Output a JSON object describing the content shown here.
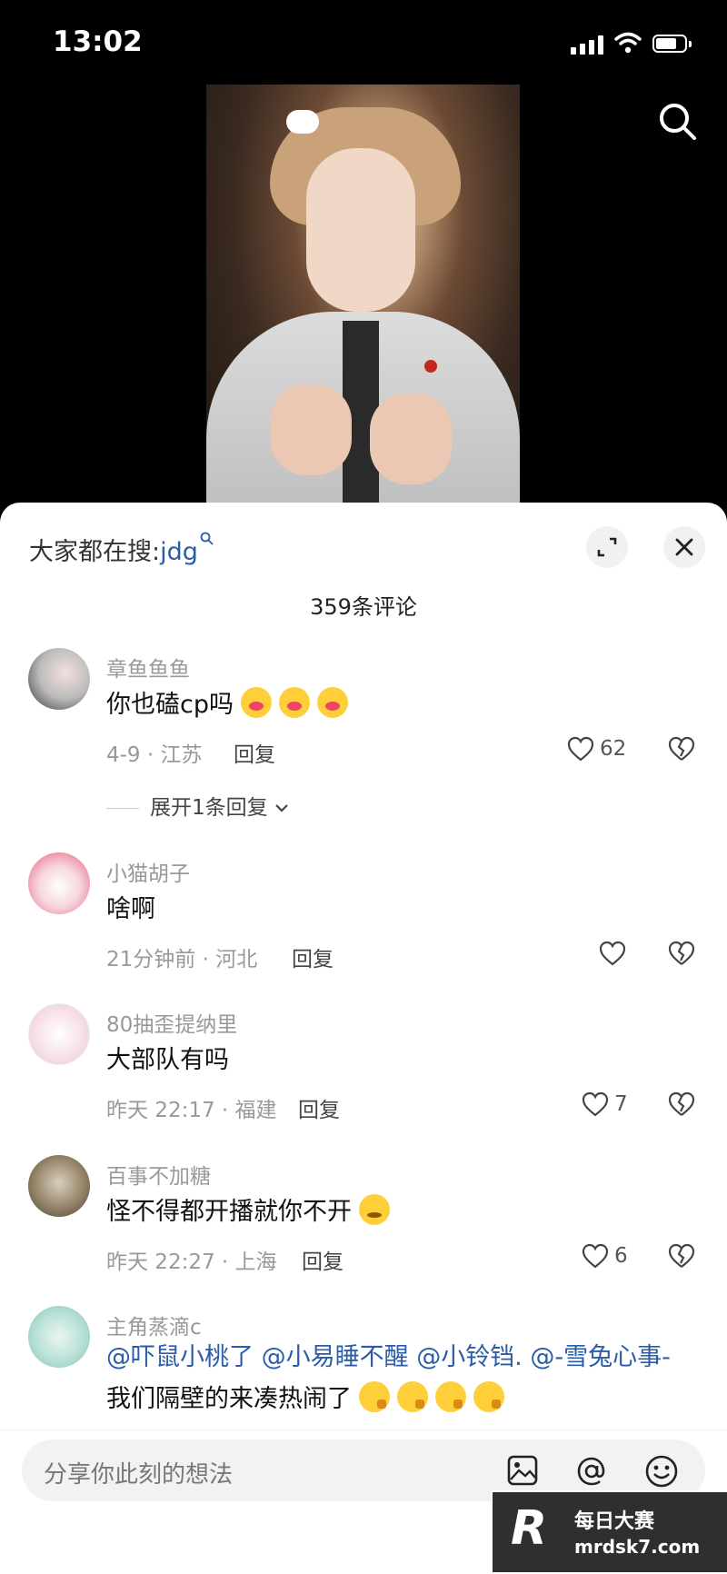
{
  "status": {
    "time": "13:02"
  },
  "video": {},
  "sheet": {
    "hot_search_label": "大家都在搜:",
    "hot_search_term": "jdg",
    "comment_count_label": "359条评论"
  },
  "comments": [
    {
      "name": "章鱼鱼鱼",
      "text": "你也磕cp吗",
      "meta": "4-9 · 江苏",
      "reply": "回复",
      "likes": "62",
      "expand": "展开1条回复",
      "emoji_count": 3
    },
    {
      "name": "小猫胡子",
      "text": "啥啊",
      "meta": "21分钟前 · 河北",
      "reply": "回复",
      "likes": ""
    },
    {
      "name": "80抽歪提纳里",
      "text": "大部队有吗",
      "meta": "昨天 22:17 · 福建",
      "reply": "回复",
      "likes": "7"
    },
    {
      "name": "百事不加糖",
      "text": "怪不得都开播就你不开",
      "meta": "昨天 22:27 · 上海",
      "reply": "回复",
      "likes": "6",
      "emoji_count": 1
    },
    {
      "name": "主角蒸滴c",
      "mentions": [
        "@吓鼠小桃了",
        "@小易睡不醒",
        "@小铃铛.",
        "@-雪兔心事-"
      ],
      "text": "我们隔壁的来凑热闹了",
      "emoji_count": 4
    }
  ],
  "input": {
    "placeholder": "分享你此刻的想法"
  },
  "watermark": {
    "line1": "每日大赛",
    "line2": "mrdsk7.com",
    "glyph": "R"
  },
  "icons": [
    "search-icon",
    "expand-icon",
    "close-icon",
    "heart-icon",
    "broken-heart-icon",
    "image-icon",
    "at-icon",
    "emoji-icon",
    "chevron-down-icon",
    "signal-icon",
    "wifi-icon",
    "battery-icon"
  ]
}
